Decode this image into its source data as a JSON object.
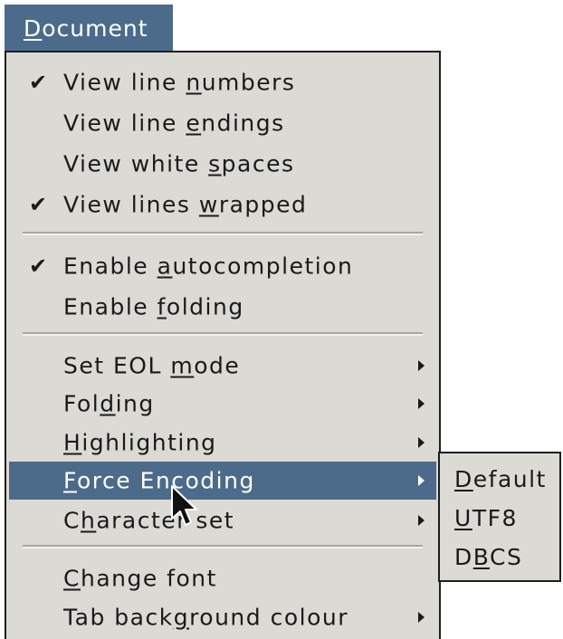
{
  "menubar": {
    "title_underline": "D",
    "title_rest": "ocument"
  },
  "menu": {
    "items": [
      {
        "checked": "✔",
        "pre": "View line ",
        "u": "n",
        "post": "umbers"
      },
      {
        "checked": "",
        "pre": "View line ",
        "u": "e",
        "post": "ndings"
      },
      {
        "checked": "",
        "pre": "View white ",
        "u": "s",
        "post": "paces"
      },
      {
        "checked": "✔",
        "pre": "View lines ",
        "u": "w",
        "post": "rapped"
      },
      {
        "checked": "✔",
        "pre": "Enable ",
        "u": "a",
        "post": "utocompletion"
      },
      {
        "checked": "",
        "pre": "Enable ",
        "u": "f",
        "post": "olding"
      },
      {
        "checked": "",
        "pre": "Set EOL ",
        "u": "m",
        "post": "ode"
      },
      {
        "checked": "",
        "pre": "Fol",
        "u": "d",
        "post": "ing"
      },
      {
        "checked": "",
        "pre": "",
        "u": "H",
        "post": "ighlighting"
      },
      {
        "checked": "",
        "pre": "",
        "u": "F",
        "post": "orce Encoding"
      },
      {
        "checked": "",
        "pre": "C",
        "u": "h",
        "post": "aracter set"
      },
      {
        "checked": "",
        "pre": "",
        "u": "C",
        "post": "hange font"
      },
      {
        "checked": "",
        "pre": "Tab back",
        "u": "g",
        "post": "round colour"
      }
    ]
  },
  "submenu": {
    "items": [
      {
        "pre": "",
        "u": "D",
        "post": "efault"
      },
      {
        "pre": "",
        "u": "U",
        "post": "TF8"
      },
      {
        "pre": "D",
        "u": "B",
        "post": "CS"
      }
    ]
  },
  "colors": {
    "highlight": "#4c6b8a",
    "menu_bg": "#dcdad5",
    "text": "#1a1a1a"
  }
}
